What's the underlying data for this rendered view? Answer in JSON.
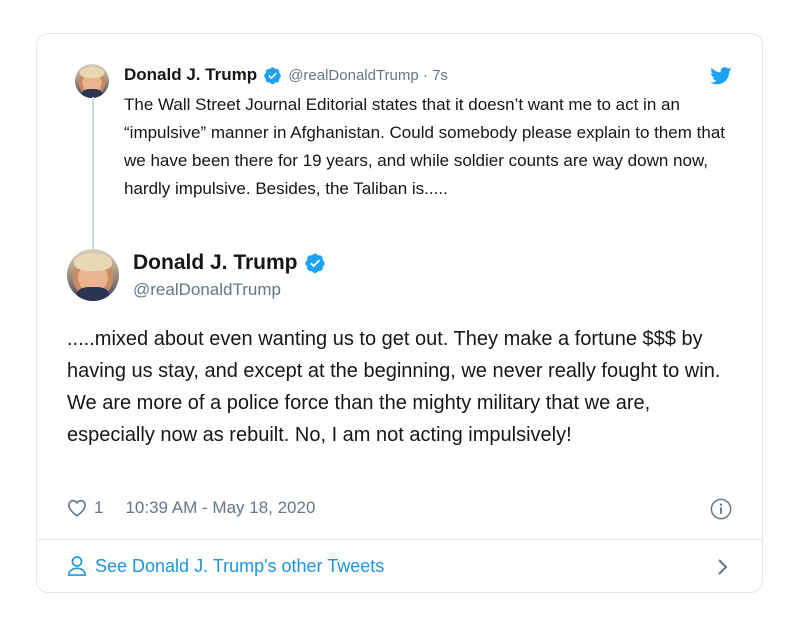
{
  "quoted": {
    "name": "Donald J. Trump",
    "handle_time": "@realDonaldTrump · 7s",
    "text": "The Wall Street Journal Editorial states that it doesn’t want me to act in an “impulsive” manner in Afghanistan. Could somebody please explain to them that we have been there for 19 years, and while soldier counts are way down now, hardly impulsive. Besides, the Taliban is....."
  },
  "main": {
    "name": "Donald J. Trump",
    "handle": "@realDonaldTrump",
    "text": ".....mixed about even wanting us to get out. They make a fortune $$$ by having us stay, and except at the beginning, we never really fought to win. We are more of a police force than the mighty military that we are, especially now as rebuilt. No, I am not acting impulsively!",
    "likes": "1",
    "timestamp": "10:39 AM - May 18, 2020"
  },
  "footer": {
    "link_text": "See Donald J. Trump's other Tweets"
  },
  "icons": {
    "verified": "verified-badge-icon",
    "bird": "twitter-bird-icon",
    "heart": "heart-icon",
    "info": "info-icon",
    "person": "person-icon",
    "chevron": "chevron-right-icon"
  },
  "colors": {
    "accent": "#1da1f2",
    "link": "#1b95e0",
    "muted": "#657786",
    "text": "#14171a"
  }
}
